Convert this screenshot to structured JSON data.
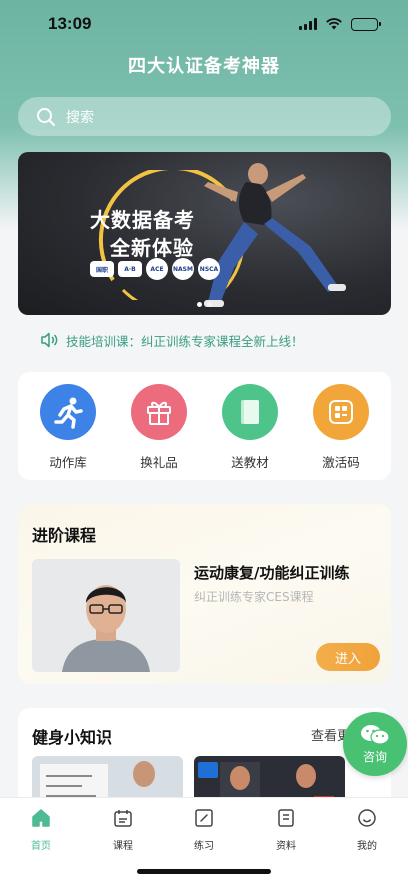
{
  "status": {
    "time": "13:09"
  },
  "header": {
    "title": "四大认证备考神器"
  },
  "search": {
    "placeholder": "搜索"
  },
  "banner": {
    "title": "大数据备考",
    "subtitle": "全新体验",
    "logos": [
      "国职",
      "A·B",
      "ACE",
      "NASM",
      "NSCA"
    ],
    "slide_count": 2,
    "active_slide": 1
  },
  "notice": {
    "text": "技能培训课：纠正训练专家课程全新上线！"
  },
  "shortcuts": [
    {
      "label": "动作库",
      "icon": "running-man-icon",
      "color": "#3d82e6"
    },
    {
      "label": "换礼品",
      "icon": "gift-icon",
      "color": "#ec6b7d"
    },
    {
      "label": "送教材",
      "icon": "book-icon",
      "color": "#4ec48a"
    },
    {
      "label": "激活码",
      "icon": "code-icon",
      "color": "#f2a63a"
    }
  ],
  "course": {
    "heading": "进阶课程",
    "title": "运动康复/功能纠正训练",
    "subtitle": "纠正训练专家CES课程",
    "enter_label": "进入"
  },
  "tips": {
    "heading": "健身小知识",
    "more_label": "查看更多"
  },
  "consult": {
    "label": "咨询",
    "icon": "wechat-icon",
    "color": "#49c173"
  },
  "tabbar": {
    "active": "首页",
    "items": [
      {
        "label": "首页",
        "icon": "home-icon"
      },
      {
        "label": "课程",
        "icon": "calendar-icon"
      },
      {
        "label": "练习",
        "icon": "pencil-icon"
      },
      {
        "label": "资料",
        "icon": "document-icon"
      },
      {
        "label": "我的",
        "icon": "smile-icon"
      }
    ]
  },
  "colors": {
    "accent": "#4dbb93",
    "header": "#6db4a3",
    "button": "#f0a239"
  }
}
